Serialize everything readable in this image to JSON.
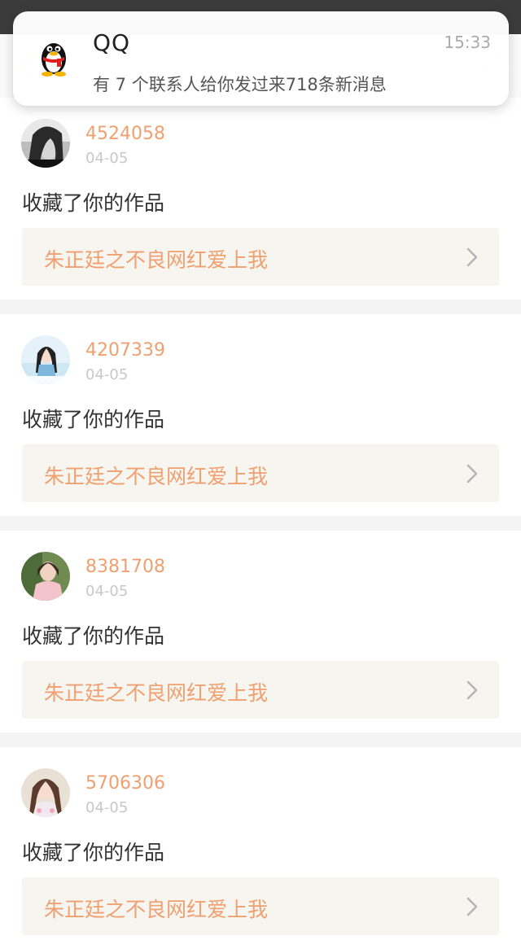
{
  "notification": {
    "app": "QQ",
    "time": "15:33",
    "message": "有 7 个联系人给你发过来718条新消息"
  },
  "feed": [
    {
      "username": "4524058",
      "date": "04-05",
      "action": "收藏了你的作品",
      "work_title": "朱正廷之不良网红爱上我"
    },
    {
      "username": "4207339",
      "date": "04-05",
      "action": "收藏了你的作品",
      "work_title": "朱正廷之不良网红爱上我"
    },
    {
      "username": "8381708",
      "date": "04-05",
      "action": "收藏了你的作品",
      "work_title": "朱正廷之不良网红爱上我"
    },
    {
      "username": "5706306",
      "date": "04-05",
      "action": "收藏了你的作品",
      "work_title": "朱正廷之不良网红爱上我"
    }
  ],
  "colors": {
    "accent": "#f0a070",
    "link_bg": "#f6f5f0",
    "separator": "#f4f4f4"
  },
  "icons": {
    "back": "back-arrow-icon",
    "qq": "qq-penguin-icon",
    "chevron": "chevron-right-icon"
  }
}
